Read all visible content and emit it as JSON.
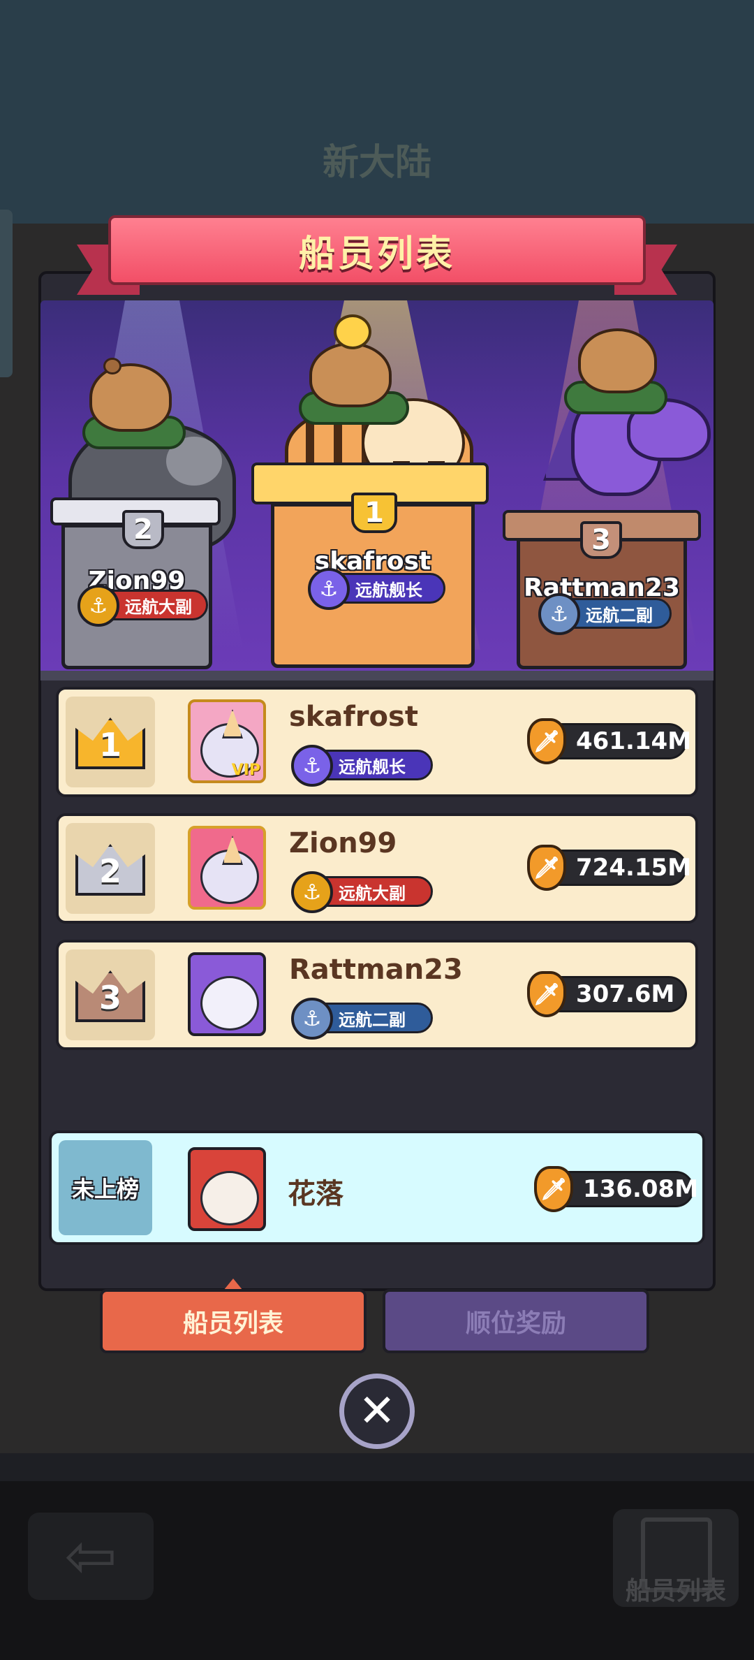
{
  "background": {
    "title": "新大陆",
    "bottom_right_label": "船员列表"
  },
  "header": {
    "title": "船员列表"
  },
  "podium": [
    {
      "rank": "2",
      "name": "Zion99",
      "title": "远航大副",
      "badge_style": "gold"
    },
    {
      "rank": "1",
      "name": "skafrost",
      "title": "远航舰长",
      "badge_style": "purple"
    },
    {
      "rank": "3",
      "name": "Rattman23",
      "title": "远航二副",
      "badge_style": "blue"
    }
  ],
  "leaderboard": [
    {
      "rank": "1",
      "name": "skafrost",
      "title": "远航舰长",
      "score": "461.14M",
      "vip": "VIP"
    },
    {
      "rank": "2",
      "name": "Zion99",
      "title": "远航大副",
      "score": "724.15M"
    },
    {
      "rank": "3",
      "name": "Rattman23",
      "title": "远航二副",
      "score": "307.6M"
    }
  ],
  "self_row": {
    "rank_label": "未上榜",
    "name": "花落",
    "score": "136.08M"
  },
  "tabs": [
    {
      "label": "船员列表",
      "active": true
    },
    {
      "label": "顺位奖励",
      "active": false
    }
  ],
  "icons": {
    "close": "close-icon",
    "score": "sword-shield-icon",
    "back": "back-arrow-icon"
  },
  "colors": {
    "ribbon": "#f24f67",
    "row_bg": "#fbeccc",
    "self_row_bg": "#d7fbff",
    "active_tab": "#e8684a",
    "inactive_tab": "#5b4a86"
  }
}
